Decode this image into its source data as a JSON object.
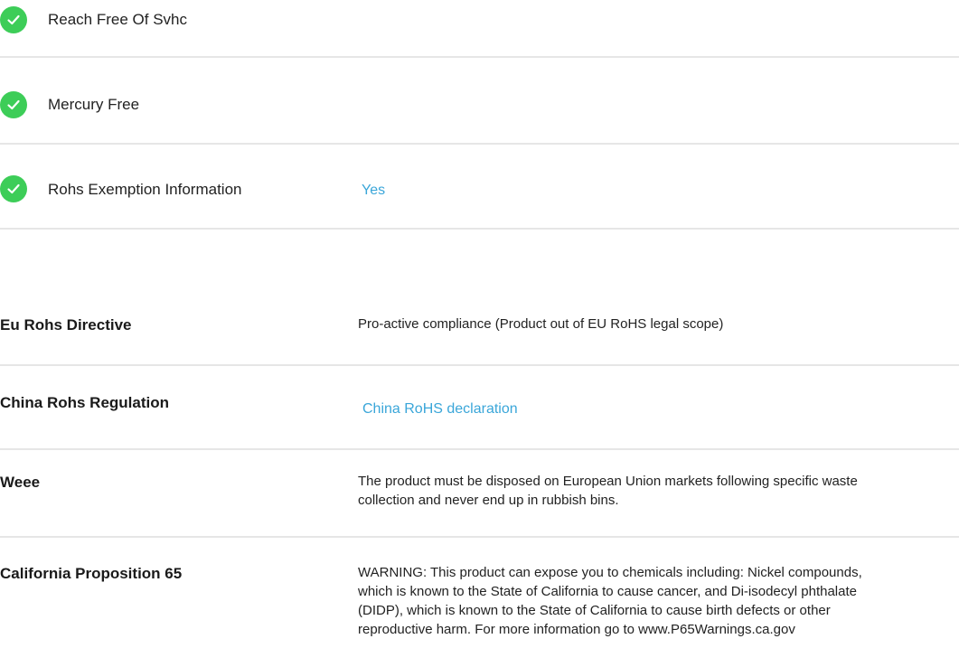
{
  "colors": {
    "check_green": "#3dcd58",
    "link_blue": "#3aa6d9",
    "divider": "#e6e6e6"
  },
  "compliance_checks": [
    {
      "label": "Reach Free Of Svhc",
      "icon": "check-circle-icon"
    },
    {
      "label": "Mercury Free",
      "icon": "check-circle-icon"
    },
    {
      "label": "Rohs Exemption Information",
      "icon": "check-circle-icon",
      "value": "Yes"
    }
  ],
  "attributes": {
    "eu_rohs": {
      "key": "Eu Rohs Directive",
      "value": "Pro-active compliance (Product out of EU RoHS legal scope)"
    },
    "china_rohs": {
      "key": "China Rohs Regulation",
      "link": "China RoHS declaration"
    },
    "weee": {
      "key": "Weee",
      "value_line1": "The product must be disposed on European Union markets following specific waste",
      "value_line2": "collection and never end up in rubbish bins."
    },
    "prop65": {
      "key": "California Proposition 65",
      "value_line1": "WARNING: This product can expose you to chemicals including: Nickel compounds,",
      "value_line2": "which is known to the State of California to cause cancer, and Di-isodecyl phthalate",
      "value_line3": "(DIDP), which is known to the State of California to cause birth defects or other",
      "value_line4": "reproductive harm. For more information go to www.P65Warnings.ca.gov"
    }
  }
}
